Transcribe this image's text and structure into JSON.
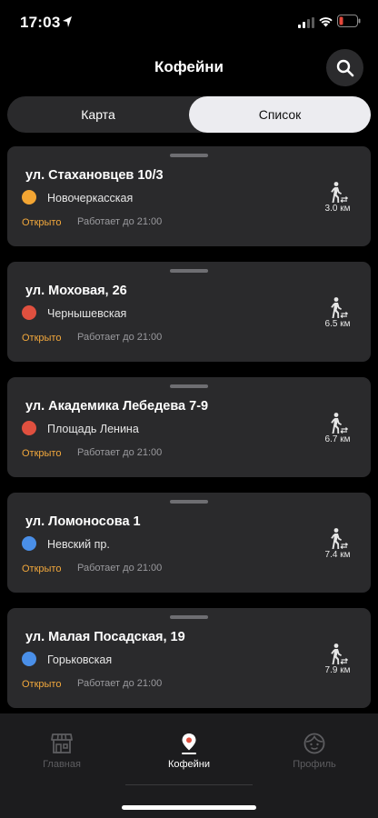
{
  "status_bar": {
    "time": "17:03"
  },
  "header": {
    "title": "Кофейни"
  },
  "segmented": {
    "map_label": "Карта",
    "list_label": "Список",
    "selected": "Список"
  },
  "cafes": [
    {
      "address": "ул. Стахановцев 10/3",
      "metro": "Новочеркасская",
      "metro_color": "#f3a533",
      "status": "Открыто",
      "hours": "Работает до 21:00",
      "distance": "3.0 км"
    },
    {
      "address": "ул. Моховая, 26",
      "metro": "Чернышевская",
      "metro_color": "#e0503f",
      "status": "Открыто",
      "hours": "Работает до 21:00",
      "distance": "6.5 км"
    },
    {
      "address": "ул. Академика Лебедева 7-9",
      "metro": "Площадь Ленина",
      "metro_color": "#e0503f",
      "status": "Открыто",
      "hours": "Работает до 21:00",
      "distance": "6.7 км"
    },
    {
      "address": "ул. Ломоносова 1",
      "metro": "Невский пр.",
      "metro_color": "#4a8fe8",
      "status": "Открыто",
      "hours": "Работает до 21:00",
      "distance": "7.4 км"
    },
    {
      "address": "ул. Малая Посадская, 19",
      "metro": "Горьковская",
      "metro_color": "#4a8fe8",
      "status": "Открыто",
      "hours": "Работает до 21:00",
      "distance": "7.9 км"
    }
  ],
  "tab_bar": {
    "items": [
      {
        "label": "Главная",
        "icon": "storefront-icon",
        "active": false
      },
      {
        "label": "Кофейни",
        "icon": "map-pin-icon",
        "active": true
      },
      {
        "label": "Профиль",
        "icon": "face-icon",
        "active": false
      }
    ]
  },
  "colors": {
    "accent_status": "#f2a83c",
    "card_bg": "#2a2a2c",
    "battery_low": "#e5473a"
  }
}
